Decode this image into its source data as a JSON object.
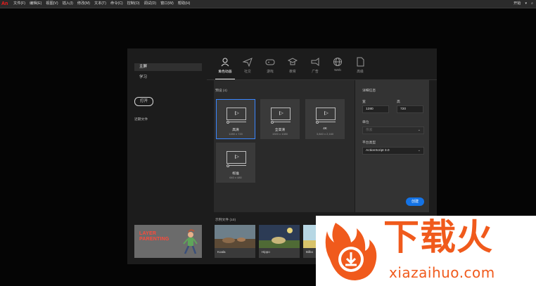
{
  "menubar": {
    "logo": "An",
    "menus": [
      "文件(F)",
      "编辑(E)",
      "视图(V)",
      "插入(I)",
      "修改(M)",
      "文本(T)",
      "命令(C)",
      "控制(O)",
      "调试(D)",
      "窗口(W)",
      "帮助(H)"
    ],
    "workspace": "开始"
  },
  "sidebar": {
    "items": [
      {
        "label": "主屏"
      },
      {
        "label": "学习"
      }
    ],
    "open_label": "打开",
    "recent_label": "近期文件",
    "promo_text": "LAYER PARENTING"
  },
  "tabs": [
    {
      "label": "角色动画",
      "icon": "character-icon"
    },
    {
      "label": "社交",
      "icon": "paper-plane-icon"
    },
    {
      "label": "游戏",
      "icon": "gamepad-icon"
    },
    {
      "label": "教育",
      "icon": "graduation-cap-icon"
    },
    {
      "label": "广告",
      "icon": "megaphone-icon"
    },
    {
      "label": "Web",
      "icon": "globe-icon"
    },
    {
      "label": "高级",
      "icon": "document-icon"
    }
  ],
  "presets": {
    "label": "预设 (4)",
    "items": [
      {
        "name": "高清",
        "dims": "1280 x 720"
      },
      {
        "name": "全高清",
        "dims": "1920 x 1080"
      },
      {
        "name": "4K",
        "dims": "3,840 x 2,160"
      },
      {
        "name": "标准",
        "dims": "640 x 480"
      }
    ]
  },
  "details": {
    "title": "详细信息",
    "width_label": "宽",
    "height_label": "高",
    "width_value": "1280",
    "height_value": "720",
    "units_label": "单位",
    "units_value": "像素",
    "platform_label": "平台类型",
    "platform_value": "ActionScript 3.0",
    "create_label": "创建"
  },
  "samples": {
    "label": "示例文件 (10)",
    "items": [
      {
        "name": "Koala"
      },
      {
        "name": "Hippo"
      },
      {
        "name": "Bilbo"
      }
    ]
  },
  "watermark": {
    "brand": "下载火",
    "site": "xiazaihuo.com"
  },
  "colors": {
    "accent": "#1473e6",
    "selection": "#3a86ff",
    "watermark": "#f05a1c"
  }
}
